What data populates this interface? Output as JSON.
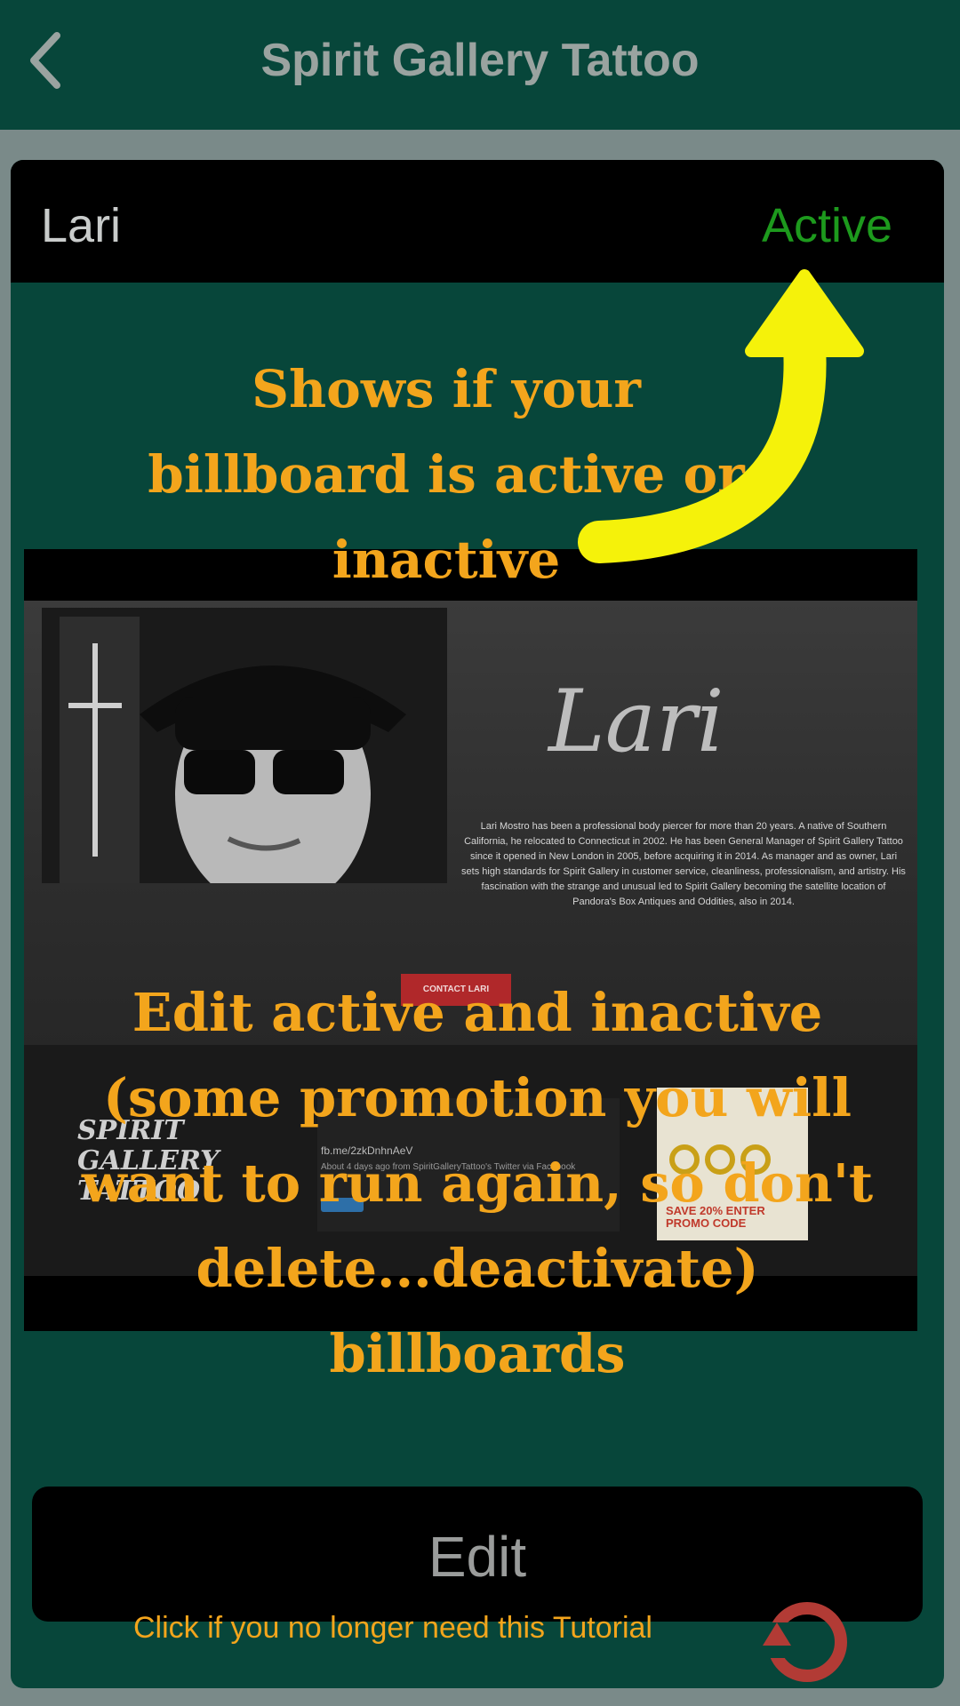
{
  "nav": {
    "title": "Spirit Gallery Tattoo"
  },
  "billboard": {
    "name": "Lari",
    "status": "Active",
    "status_color": "#1d9a1d",
    "image": {
      "script_name": "Lari",
      "bio": "Lari Mostro has been a professional body piercer for more than 20 years. A native of Southern California, he relocated to Connecticut in 2002. He has been General Manager of Spirit Gallery Tattoo since it opened in New London in 2005, before acquiring it in 2014. As manager and as owner, Lari sets high standards for Spirit Gallery in customer service, cleanliness, professionalism, and artistry. His fascination with the strange and unusual led to Spirit Gallery becoming the satellite location of Pandora's Box Antiques and Oddities, also in 2014.",
      "contact_label": "CONTACT LARI",
      "logo_lines": [
        "SPIRIT",
        "GALLERY",
        "TATTOO"
      ],
      "tweet_link": "fb.me/2zkDnhnAeV",
      "tweet_meta": "About 4 days ago from SpiritGalleryTattoo's Twitter via Facebook",
      "promo_lines": [
        "SAVE 20% ENTER",
        "PROMO CODE"
      ]
    }
  },
  "annotations": {
    "active_note": [
      "Shows if your",
      "billboard is active or",
      "inactive"
    ],
    "edit_note": [
      "Edit active and inactive",
      "(some promotion you will",
      "want to run again, so don't",
      "delete...deactivate)",
      "billboards"
    ],
    "text_color": "#f3a51c",
    "arrow_color": "#f5f20a"
  },
  "edit_button": {
    "label": "Edit"
  },
  "tutorial": {
    "dismiss_text": "Click if you no longer need this Tutorial"
  },
  "icons": {
    "back": "chevron-left-icon",
    "dismiss": "circular-arrow-icon"
  }
}
